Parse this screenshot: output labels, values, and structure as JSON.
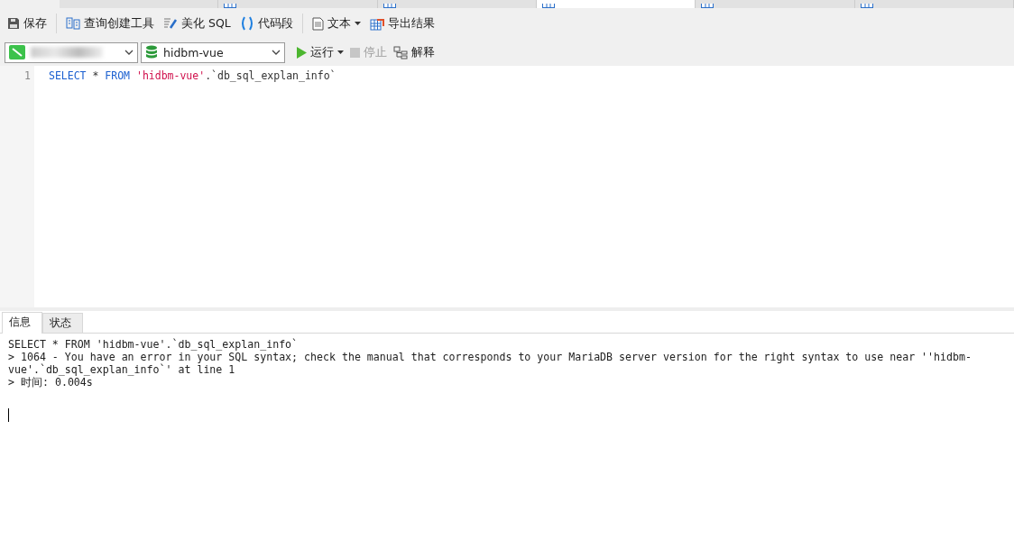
{
  "doc_tabs": [
    {
      "kind": "plain",
      "selected": false
    },
    {
      "kind": "table",
      "selected": false
    },
    {
      "kind": "table",
      "selected": false
    },
    {
      "kind": "table",
      "selected": true
    },
    {
      "kind": "table",
      "selected": false
    },
    {
      "kind": "table",
      "selected": false
    }
  ],
  "toolbar": [
    {
      "kind": "button",
      "label": "保存"
    },
    {
      "kind": "separator"
    },
    {
      "kind": "button",
      "label": "查询创建工具"
    },
    {
      "kind": "button",
      "label": "美化 SQL"
    },
    {
      "kind": "button",
      "label": "代码段"
    },
    {
      "kind": "separator"
    },
    {
      "kind": "dropdown",
      "label": "文本"
    },
    {
      "kind": "button",
      "label": "导出结果"
    }
  ],
  "database_select": {
    "value": "hidbm-vue"
  },
  "run_bar": [
    {
      "kind": "dropdown",
      "label": "运行",
      "disabled": false
    },
    {
      "kind": "button",
      "label": "停止",
      "disabled": true
    },
    {
      "kind": "button",
      "label": "解释",
      "disabled": false
    }
  ],
  "editor": {
    "lines": [
      {
        "number": "1",
        "tokens": [
          {
            "kind": "keyword",
            "text": "SELECT"
          },
          {
            "kind": "plain",
            "text": " * "
          },
          {
            "kind": "keyword",
            "text": "FROM"
          },
          {
            "kind": "string",
            "text": " 'hidbm-vue'"
          },
          {
            "kind": "plain",
            "text": ".`db_sql_explan_info`"
          }
        ]
      }
    ]
  },
  "result_tabs": [
    {
      "label": "信息",
      "selected": true
    },
    {
      "label": "状态",
      "selected": false
    }
  ],
  "output_lines": [
    "SELECT * FROM 'hidbm-vue'.`db_sql_explan_info`",
    "> 1064 - You have an error in your SQL syntax; check the manual that corresponds to your MariaDB server version for the right syntax to use near ''hidbm-",
    "vue'.`db_sql_explan_info`' at line 1",
    "> 时间: 0.004s"
  ]
}
